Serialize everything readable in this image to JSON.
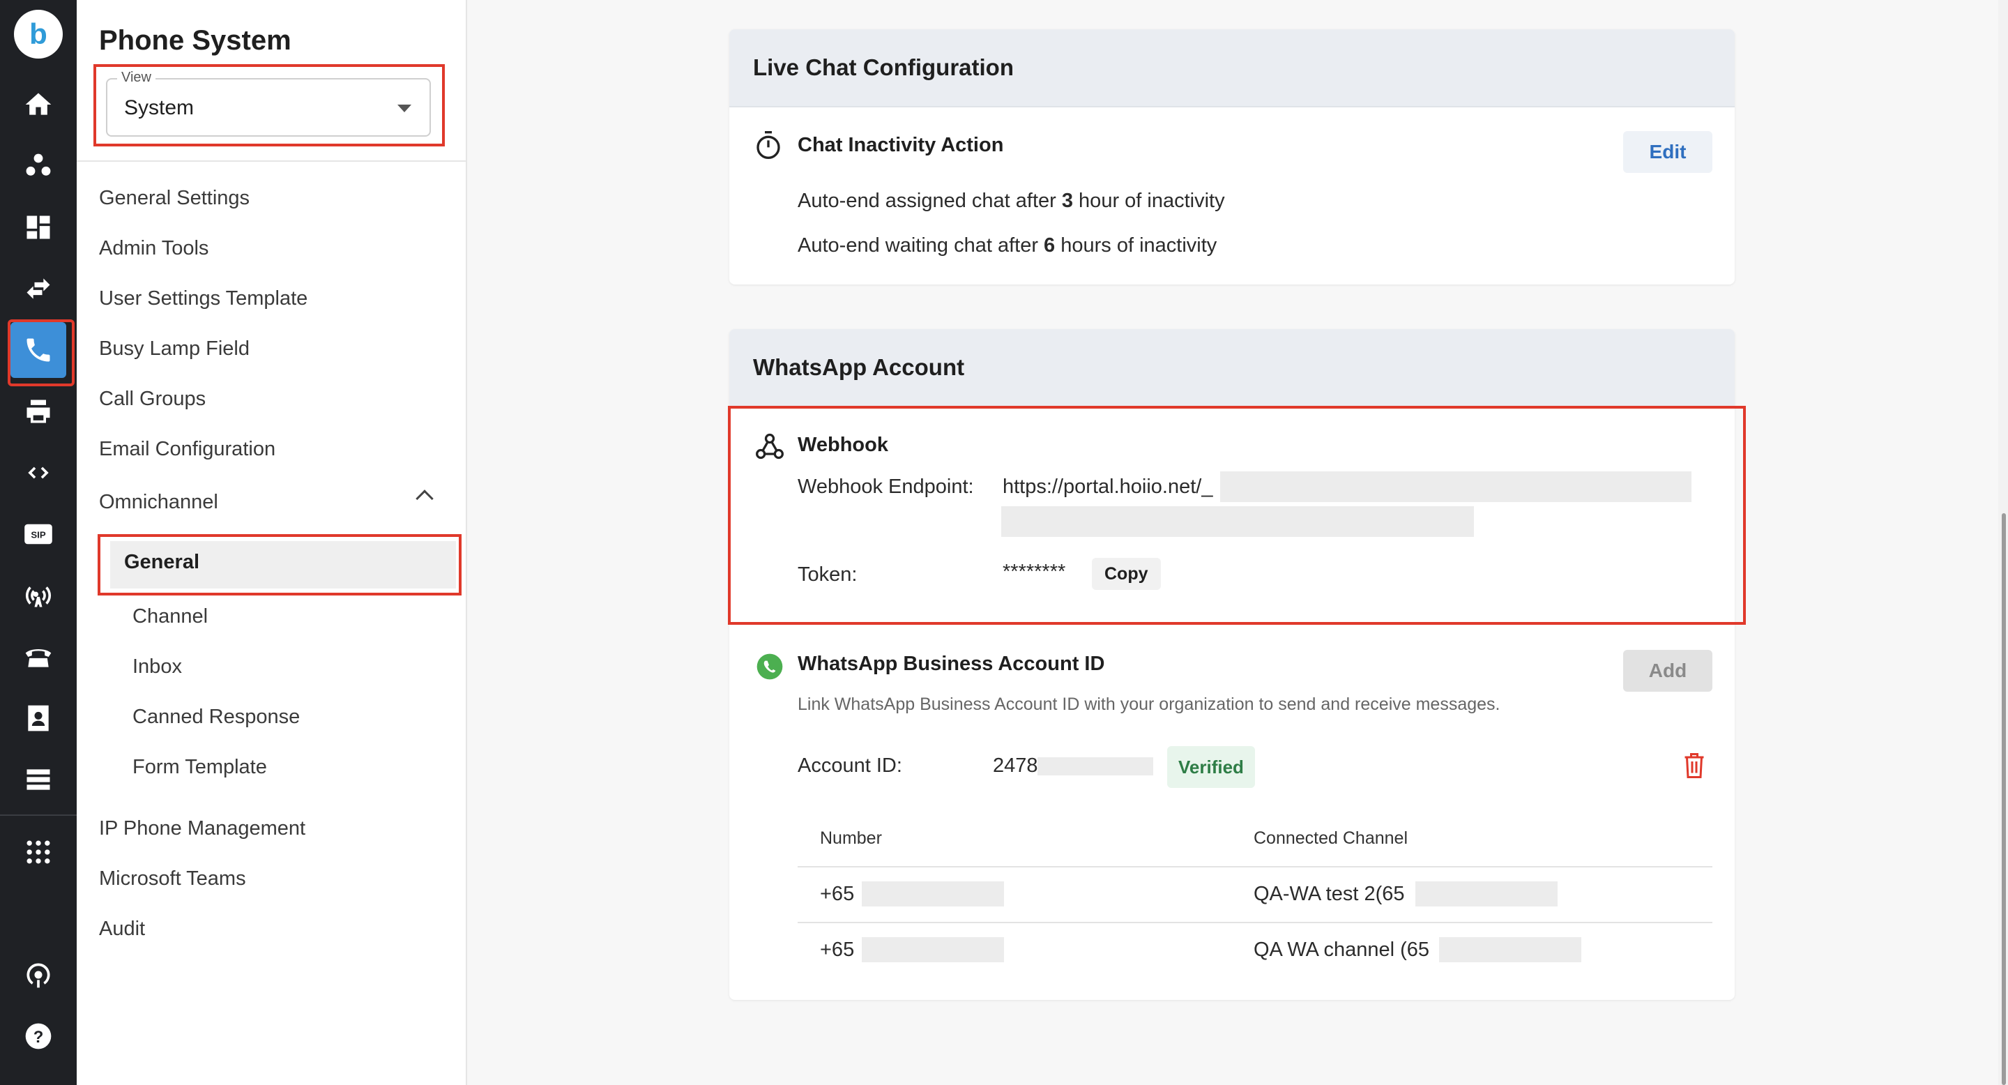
{
  "rail": {
    "logo_glyph": "b",
    "icons": [
      "home-icon",
      "contacts-icon",
      "dashboard-icon",
      "transfer-icon",
      "phone-icon",
      "printer-icon",
      "code-icon",
      "sip-icon",
      "antenna-icon",
      "desk-phone-icon",
      "directory-icon",
      "server-icon",
      "apps-grid-icon",
      "podcast-icon",
      "help-icon"
    ],
    "active": "phone-icon",
    "sip_label": "SIP"
  },
  "sidebar": {
    "title": "Phone System",
    "view_legend": "View",
    "view_value": "System",
    "items": [
      {
        "label": "General Settings"
      },
      {
        "label": "Admin Tools"
      },
      {
        "label": "User Settings Template"
      },
      {
        "label": "Busy Lamp Field"
      },
      {
        "label": "Call Groups"
      },
      {
        "label": "Email Configuration"
      },
      {
        "label": "Omnichannel"
      },
      {
        "label": "IP Phone Management"
      },
      {
        "label": "Microsoft Teams"
      },
      {
        "label": "Audit"
      }
    ],
    "omnichannel_sub": [
      {
        "label": "General",
        "active": true
      },
      {
        "label": "Channel"
      },
      {
        "label": "Inbox"
      },
      {
        "label": "Canned Response"
      },
      {
        "label": "Form Template"
      }
    ]
  },
  "live_chat": {
    "title": "Live Chat Configuration",
    "row_title": "Chat Inactivity Action",
    "edit_label": "Edit",
    "line1_pre": "Auto-end assigned chat after ",
    "line1_num": "3",
    "line1_post": " hour of inactivity",
    "line2_pre": "Auto-end waiting chat after ",
    "line2_num": "6",
    "line2_post": " hours of inactivity"
  },
  "whatsapp": {
    "title": "WhatsApp Account",
    "webhook_title": "Webhook",
    "endpoint_label": "Webhook Endpoint:",
    "endpoint_value": "https://portal.hoiio.net/_",
    "token_label": "Token:",
    "token_value": "********",
    "copy_label": "Copy",
    "waba_title": "WhatsApp Business Account ID",
    "add_label": "Add",
    "waba_desc": "Link WhatsApp Business Account ID with your organization to send and receive messages.",
    "account_label": "Account ID:",
    "account_value": "2478",
    "verified_label": "Verified",
    "table": {
      "headers": [
        "Number",
        "Connected Channel"
      ],
      "rows": [
        {
          "number": "+65",
          "channel": "QA-WA test 2(65"
        },
        {
          "number": "+65",
          "channel": "QA WA channel (65"
        }
      ]
    }
  },
  "colors": {
    "rail_bg": "#1f2125",
    "active_bg": "#3d8fd8",
    "highlight": "#e0392b",
    "whatsapp_green": "#4caf50",
    "delete_red": "#e0392b"
  }
}
